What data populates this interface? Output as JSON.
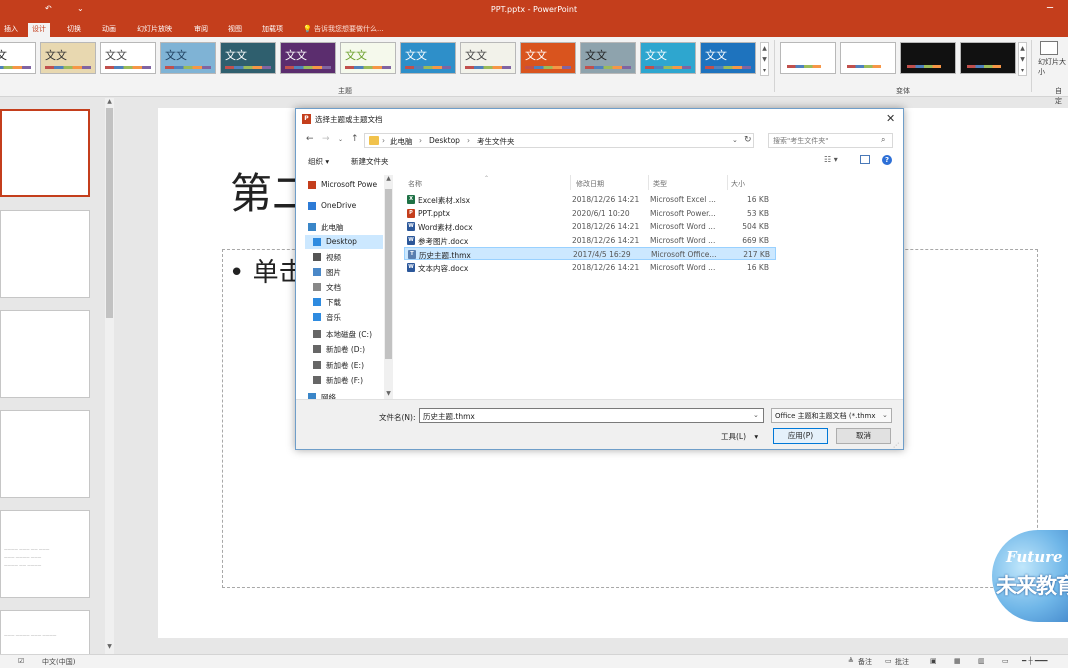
{
  "window": {
    "title": "PPT.pptx - PowerPoint"
  },
  "ribbon": {
    "tabs": [
      {
        "label": "插入",
        "active": false
      },
      {
        "label": "设计",
        "active": true
      },
      {
        "label": "切换",
        "active": false
      },
      {
        "label": "动画",
        "active": false
      },
      {
        "label": "幻灯片放映",
        "active": false
      },
      {
        "label": "审阅",
        "active": false
      },
      {
        "label": "视图",
        "active": false
      },
      {
        "label": "加载项",
        "active": false
      }
    ],
    "tell_me": "告诉我您想要做什么...",
    "themes_group_label": "主题",
    "variants_group_label": "变体",
    "theme_sample_text": "文文",
    "slide_size_label": "幻灯片大小",
    "customize_label": "自定",
    "themes": [
      {
        "bg": "#ffffff",
        "fg": "#222222"
      },
      {
        "bg": "#e8d8b0",
        "fg": "#333333"
      },
      {
        "bg": "#ffffff",
        "fg": "#444444"
      },
      {
        "bg": "#7fb3d5",
        "fg": "#1d3d5c"
      },
      {
        "bg": "#2f5f6e",
        "fg": "#ffffff"
      },
      {
        "bg": "#5b2d6e",
        "fg": "#ffffff"
      },
      {
        "bg": "#f5f9ec",
        "fg": "#6a9f2a"
      },
      {
        "bg": "#2e8fc9",
        "fg": "#ffffff"
      },
      {
        "bg": "#f2f2ea",
        "fg": "#444444"
      },
      {
        "bg": "#d9541e",
        "fg": "#ffffff"
      },
      {
        "bg": "#8ea3ad",
        "fg": "#222222"
      },
      {
        "bg": "#2ea6cf",
        "fg": "#ffffff"
      },
      {
        "bg": "#1e73be",
        "fg": "#ffffff"
      }
    ],
    "variants": [
      {
        "bg": "#ffffff"
      },
      {
        "bg": "#ffffff"
      },
      {
        "bg": "#111111"
      },
      {
        "bg": "#111111"
      }
    ]
  },
  "slide": {
    "title_partial": "第二",
    "content_partial": "• 单击"
  },
  "statusbar": {
    "language": "中文(中国)",
    "notes": "备注",
    "comments": "批注"
  },
  "watermark": {
    "line1": "Future",
    "line2": "未来教育"
  },
  "dialog": {
    "title": "选择主题或主题文档",
    "address": {
      "crumbs": [
        "此电脑",
        "Desktop",
        "考生文件夹"
      ]
    },
    "search_placeholder": "搜索\"考生文件夹\"",
    "toolbar": {
      "organize": "组织 ▾",
      "new_folder": "新建文件夹"
    },
    "nav_items": [
      {
        "label": "Microsoft Powe",
        "icon": "powerpoint-icon",
        "color": "#c43e1c",
        "selected": false
      },
      {
        "label": "OneDrive",
        "icon": "cloud-icon",
        "color": "#2d7bd6",
        "selected": false
      },
      {
        "label": "此电脑",
        "icon": "computer-icon",
        "color": "#3a86c8",
        "selected": false
      },
      {
        "label": "Desktop",
        "icon": "desktop-icon",
        "color": "#2e8be0",
        "selected": true
      },
      {
        "label": "视频",
        "icon": "video-icon",
        "color": "#555555",
        "selected": false
      },
      {
        "label": "图片",
        "icon": "picture-icon",
        "color": "#4a88c8",
        "selected": false
      },
      {
        "label": "文档",
        "icon": "document-icon",
        "color": "#888888",
        "selected": false
      },
      {
        "label": "下载",
        "icon": "download-icon",
        "color": "#2e8be0",
        "selected": false
      },
      {
        "label": "音乐",
        "icon": "music-icon",
        "color": "#2e8be0",
        "selected": false
      },
      {
        "label": "本地磁盘 (C:)",
        "icon": "drive-icon",
        "color": "#666666",
        "selected": false
      },
      {
        "label": "新加卷 (D:)",
        "icon": "drive-icon",
        "color": "#666666",
        "selected": false
      },
      {
        "label": "新加卷 (E:)",
        "icon": "drive-icon",
        "color": "#666666",
        "selected": false
      },
      {
        "label": "新加卷 (F:)",
        "icon": "drive-icon",
        "color": "#666666",
        "selected": false
      },
      {
        "label": "网络",
        "icon": "network-icon",
        "color": "#3a86c8",
        "selected": false
      }
    ],
    "columns": {
      "name": "名称",
      "date": "修改日期",
      "type": "类型",
      "size": "大小"
    },
    "files": [
      {
        "name": "Excel素材.xlsx",
        "date": "2018/12/26 14:21",
        "type": "Microsoft Excel ...",
        "size": "16 KB",
        "icon": "excel-file-icon",
        "color": "#1e7145",
        "glyph": "X",
        "selected": false
      },
      {
        "name": "PPT.pptx",
        "date": "2020/6/1 10:20",
        "type": "Microsoft Power...",
        "size": "53 KB",
        "icon": "powerpoint-file-icon",
        "color": "#c43e1c",
        "glyph": "P",
        "selected": false
      },
      {
        "name": "Word素材.docx",
        "date": "2018/12/26 14:21",
        "type": "Microsoft Word ...",
        "size": "504 KB",
        "icon": "word-file-icon",
        "color": "#2b579a",
        "glyph": "W",
        "selected": false
      },
      {
        "name": "参考图片.docx",
        "date": "2018/12/26 14:21",
        "type": "Microsoft Word ...",
        "size": "669 KB",
        "icon": "word-file-icon",
        "color": "#2b579a",
        "glyph": "W",
        "selected": false
      },
      {
        "name": "历史主题.thmx",
        "date": "2017/4/5 16:29",
        "type": "Microsoft Office...",
        "size": "217 KB",
        "icon": "theme-file-icon",
        "color": "#5a7fb0",
        "glyph": "T",
        "selected": true
      },
      {
        "name": "文本内容.docx",
        "date": "2018/12/26 14:21",
        "type": "Microsoft Word ...",
        "size": "16 KB",
        "icon": "word-file-icon",
        "color": "#2b579a",
        "glyph": "W",
        "selected": false
      }
    ],
    "filename_label": "文件名(N):",
    "filename_value": "历史主题.thmx",
    "filetype_value": "Office 主题和主题文档 (*.thmx",
    "tools_label": "工具(L)",
    "apply_label": "应用(P)",
    "cancel_label": "取消"
  }
}
